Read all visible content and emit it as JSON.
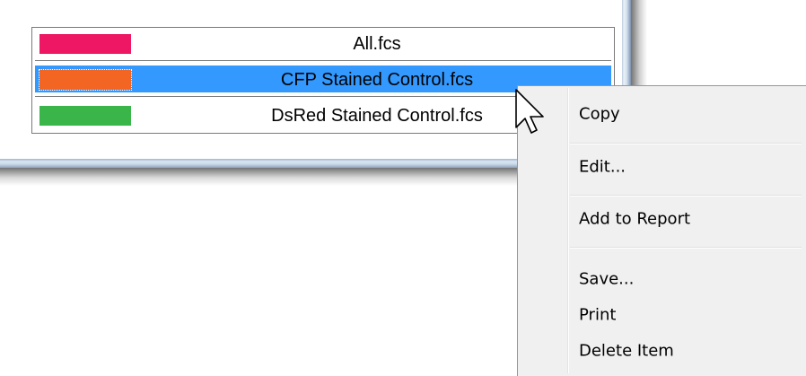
{
  "legend": {
    "items": [
      {
        "label": "All.fcs",
        "color": "#ee1763",
        "selected": false
      },
      {
        "label": "CFP Stained Control.fcs",
        "color": "#f26522",
        "selected": true
      },
      {
        "label": "DsRed Stained Control.fcs",
        "color": "#39b54a",
        "selected": false
      }
    ],
    "selection_color": "#3399ff"
  },
  "context_menu": {
    "items": [
      {
        "label": "Copy"
      },
      {
        "label": "Edit..."
      },
      {
        "label": "Add to Report"
      },
      {
        "label": "Save..."
      },
      {
        "label": "Print"
      },
      {
        "label": "Delete Item"
      }
    ]
  },
  "cursor": {
    "icon": "arrow-cursor-icon"
  }
}
